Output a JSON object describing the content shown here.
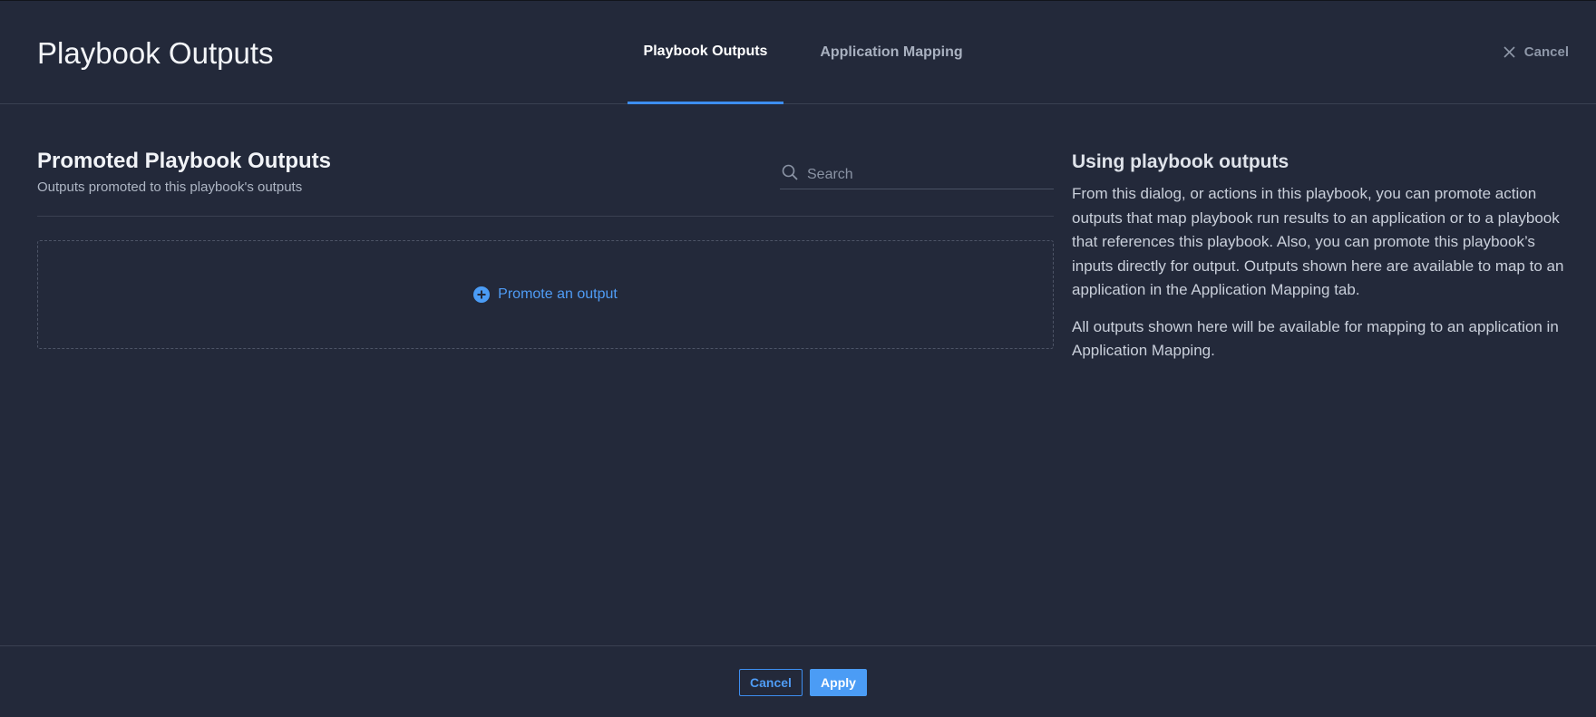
{
  "dialog": {
    "title": "Playbook Outputs",
    "tabs": [
      {
        "label": "Playbook Outputs",
        "active": true
      },
      {
        "label": "Application Mapping",
        "active": false
      }
    ],
    "header_cancel_label": "Cancel"
  },
  "main": {
    "section_title": "Promoted Playbook Outputs",
    "section_subtitle": "Outputs promoted to this playbook's outputs",
    "search": {
      "placeholder": "Search",
      "value": ""
    },
    "promote_label": "Promote an output"
  },
  "info": {
    "title": "Using playbook outputs",
    "paragraphs": [
      "From this dialog, or actions in this playbook, you can promote action outputs that map playbook run results to an application or to a playbook that references this playbook. Also, you can promote this playbook’s inputs directly for output. Outputs shown here are available to map to an application in the Application Mapping tab.",
      "All outputs shown here will be available for mapping to an application in Application Mapping."
    ]
  },
  "footer": {
    "cancel_label": "Cancel",
    "apply_label": "Apply"
  },
  "colors": {
    "background": "#23293a",
    "accent": "#3d8ef0",
    "link": "#4f9cf5",
    "divider": "#3a4152"
  },
  "icons": {
    "close": "close-icon",
    "search": "search-icon",
    "add": "plus-circle-icon"
  }
}
